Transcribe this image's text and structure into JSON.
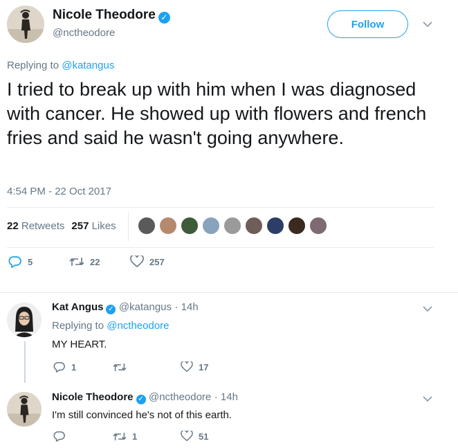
{
  "main_tweet": {
    "display_name": "Nicole Theodore",
    "handle": "@nctheodore",
    "follow_label": "Follow",
    "replying_prefix": "Replying to ",
    "replying_to": "@katangus",
    "text": "I tried to break up with him when I was diagnosed with cancer. He showed up with flowers and french fries and said he wasn't going anywhere.",
    "timestamp": "4:54 PM - 22 Oct 2017",
    "retweets_count": "22",
    "retweets_label": "Retweets",
    "likes_count": "257",
    "likes_label": "Likes",
    "actions": {
      "replies": "5",
      "retweets": "22",
      "likes": "257"
    }
  },
  "replies": [
    {
      "display_name": "Kat Angus",
      "handle": "@katangus",
      "time": "· 14h",
      "replying_prefix": "Replying to ",
      "replying_to": "@nctheodore",
      "text": "MY HEART.",
      "actions": {
        "replies": "1",
        "retweets": "",
        "likes": "17"
      }
    },
    {
      "display_name": "Nicole Theodore",
      "handle": "@nctheodore",
      "time": "· 14h",
      "text": "I'm still convinced he's not of this earth.",
      "actions": {
        "replies": "",
        "retweets": "1",
        "likes": "51"
      }
    }
  ],
  "colors": {
    "accent": "#1da1f2",
    "muted": "#657786",
    "text": "#14171a",
    "divider": "#e6ecf0"
  }
}
